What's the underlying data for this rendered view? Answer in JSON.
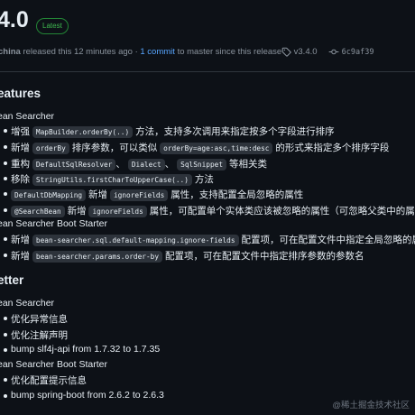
{
  "release": {
    "version": "4.0",
    "badge": "Latest"
  },
  "meta": {
    "author": "china",
    "released_text": "released this 12 minutes ago",
    "commit_link": "1 commit",
    "commit_text": "to master since this release",
    "tag": "v3.4.0",
    "commit_hash": "6c9af39"
  },
  "features": {
    "heading": "eatures",
    "sub1": "ean Searcher",
    "i1": {
      "pre": "增强",
      "code": "MapBuilder.orderBy(..)",
      "post": "方法，支持多次调用来指定按多个字段进行排序"
    },
    "i2": {
      "pre": "新增",
      "code1": "orderBy",
      "mid": "排序参数，可以类似",
      "code2": "orderBy=age:asc,time:desc",
      "post": "的形式来指定多个排序字段"
    },
    "i3": {
      "pre": "重构",
      "code1": "DefaultSqlResolver",
      "sep1": "、",
      "code2": "Dialect",
      "sep2": "、",
      "code3": "SqlSnippet",
      "post": "等相关类"
    },
    "i4": {
      "pre": "移除",
      "code": "StringUtils.firstCharToUpperCase(..)",
      "post": "方法"
    },
    "i5": {
      "code1": "DefaultDbMapping",
      "mid": "新增",
      "code2": "ignoreFields",
      "post": "属性，支持配置全局忽略的属性"
    },
    "i6": {
      "code1": "@SearchBean",
      "mid": "新增",
      "code2": "ignoreFields",
      "post": "属性，可配置单个实体类应该被忽略的属性（可忽略父类中的属性）"
    },
    "sub2": "ean Searcher Boot Starter",
    "i7": {
      "pre": "新增",
      "code": "bean-searcher.sql.default-mapping.ignore-fields",
      "post": "配置项，可在配置文件中指定全局忽略的属性"
    },
    "i8": {
      "pre": "新增",
      "code": "bean-searcher.params.order-by",
      "post": "配置项，可在配置文件中指定排序参数的参数名"
    }
  },
  "better": {
    "heading": "etter",
    "sub1": "ean Searcher",
    "items1": [
      "优化异常信息",
      "优化注解声明",
      "bump slf4j-api from 1.7.32 to 1.7.35"
    ],
    "sub2": "ean Searcher Boot Starter",
    "items2": [
      "优化配置提示信息",
      "bump spring-boot from 2.6.2 to 2.6.3"
    ]
  },
  "watermark": "@稀土掘金技术社区"
}
